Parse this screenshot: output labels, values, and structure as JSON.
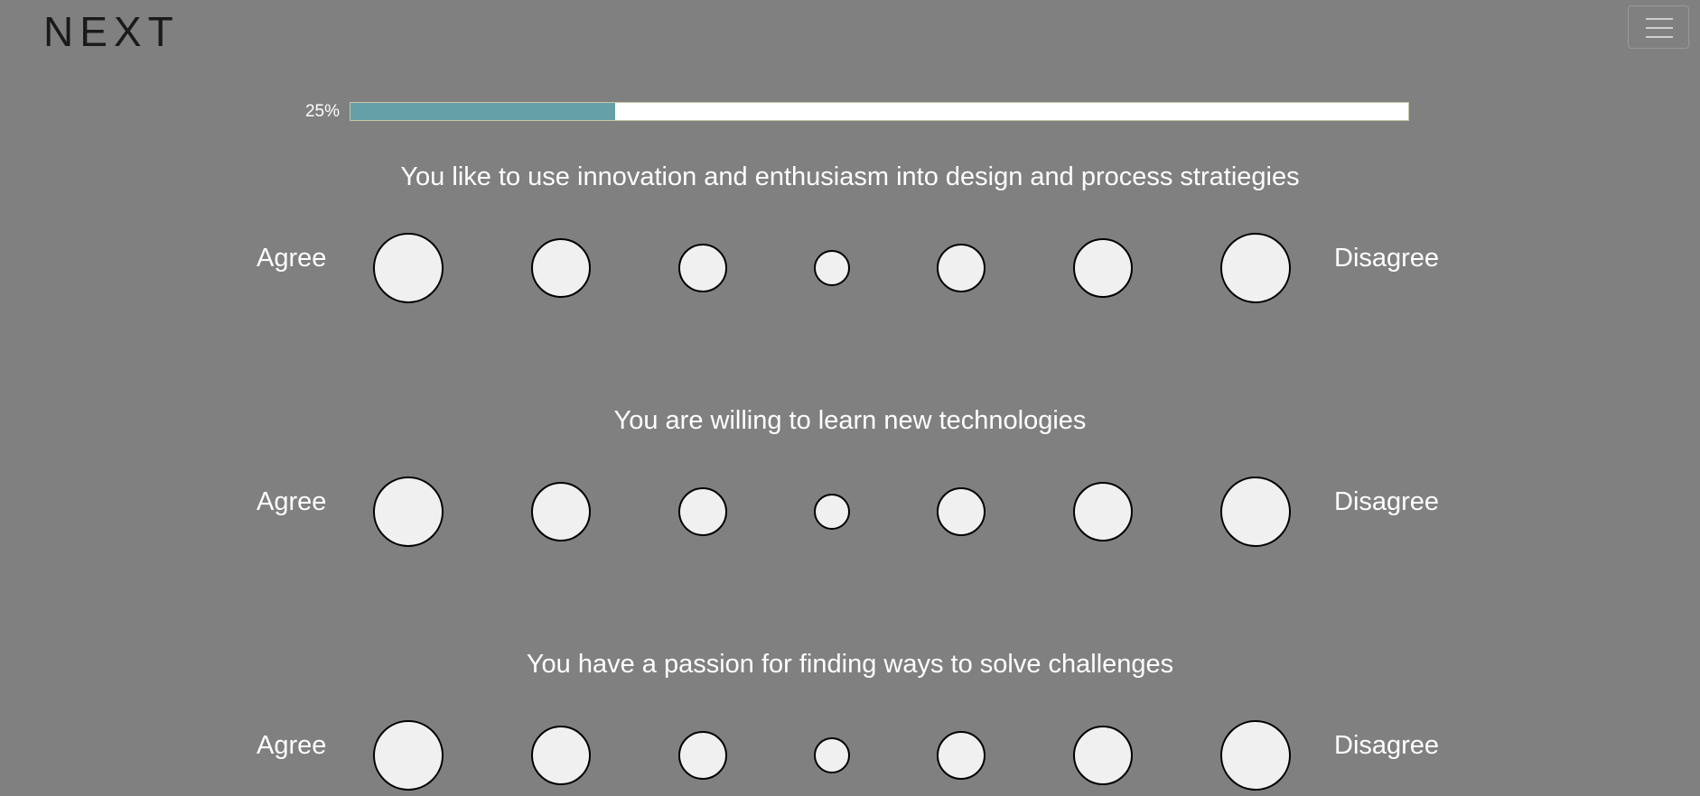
{
  "header": {
    "logo": "NEXT",
    "menu_icon": "hamburger-icon"
  },
  "progress": {
    "label": "25%",
    "value": 0.25,
    "fill_color": "#65a0a8"
  },
  "questions": [
    {
      "text": "You like to use innovation and enthusiasm into design and process stratiegies",
      "left_label": "Agree",
      "right_label": "Disagree"
    },
    {
      "text": "You are willing to learn new technologies",
      "left_label": "Agree",
      "right_label": "Disagree"
    },
    {
      "text": "You have a passion for finding ways to solve challenges",
      "left_label": "Agree",
      "right_label": "Disagree"
    }
  ]
}
